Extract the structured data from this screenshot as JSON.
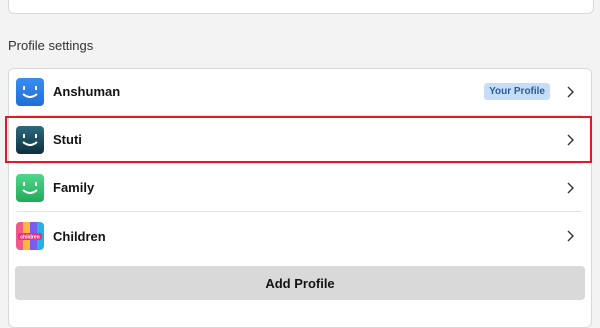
{
  "section": {
    "title": "Profile settings"
  },
  "profiles": [
    {
      "name": "Anshuman",
      "badge": "Your Profile",
      "avatar_color": "#2d7fe0",
      "avatar_icon": "smiley-face-icon"
    },
    {
      "name": "Stuti",
      "avatar_color": "#1d4b5c",
      "avatar_icon": "smiley-face-icon"
    },
    {
      "name": "Family",
      "avatar_color": "#2fbf6a",
      "avatar_icon": "smiley-face-icon"
    },
    {
      "name": "Children",
      "avatar_color": "#f0508a",
      "avatar_icon": "children-logo-icon",
      "avatar_text": "children"
    }
  ],
  "actions": {
    "add_profile": "Add Profile"
  },
  "colors": {
    "highlight": "#e01b24",
    "badge_bg": "#c6ddf7"
  }
}
